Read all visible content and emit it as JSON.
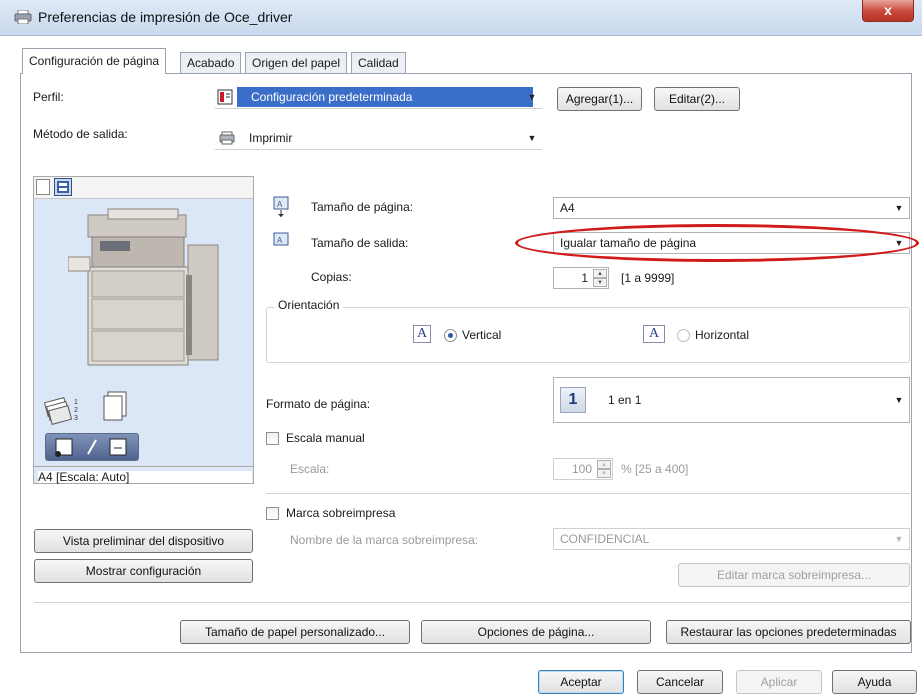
{
  "window": {
    "title": "Preferencias de impresión de Oce_driver",
    "close_label": "x"
  },
  "tabs": [
    {
      "label": "Configuración de página"
    },
    {
      "label": "Acabado"
    },
    {
      "label": "Origen del papel"
    },
    {
      "label": "Calidad"
    }
  ],
  "profile": {
    "label": "Perfil:",
    "value": "Configuración predeterminada",
    "add_label": "Agregar(1)...",
    "edit_label": "Editar(2)..."
  },
  "output_method": {
    "label": "Método de salida:",
    "value": "Imprimir"
  },
  "preview": {
    "caption": "A4 [Escala: Auto]",
    "device_preview_label": "Vista preliminar del dispositivo",
    "show_settings_label": "Mostrar configuración"
  },
  "page_size": {
    "label": "Tamaño de página:",
    "value": "A4"
  },
  "output_size": {
    "label": "Tamaño de salida:",
    "value": "Igualar tamaño de página"
  },
  "copies": {
    "label": "Copias:",
    "value": "1",
    "range": "[1 a 9999]"
  },
  "orientation": {
    "title": "Orientación",
    "portrait_label": "Vertical",
    "landscape_label": "Horizontal",
    "selected": "Vertical",
    "icon_glyph": "A"
  },
  "page_layout": {
    "label": "Formato de página:",
    "value": "1 en 1",
    "icon_number": "1"
  },
  "manual_scale": {
    "label": "Escala manual",
    "scale_label": "Escala:",
    "scale_value": "100",
    "scale_range": "% [25 a 400]"
  },
  "watermark": {
    "label": "Marca sobreimpresa",
    "name_label": "Nombre de la marca sobreimpresa:",
    "name_value": "CONFIDENCIAL",
    "edit_label": "Editar marca sobreimpresa..."
  },
  "bottom_row": {
    "custom_paper_label": "Tamaño de papel personalizado...",
    "page_options_label": "Opciones de página...",
    "restore_label": "Restaurar las opciones predeterminadas"
  },
  "dialog_buttons": {
    "ok": "Aceptar",
    "cancel": "Cancelar",
    "apply": "Aplicar",
    "help": "Ayuda"
  },
  "colors": {
    "accent": "#3c7fb1",
    "highlight": "#3a6ec9",
    "annotation": "#d11a1a"
  }
}
